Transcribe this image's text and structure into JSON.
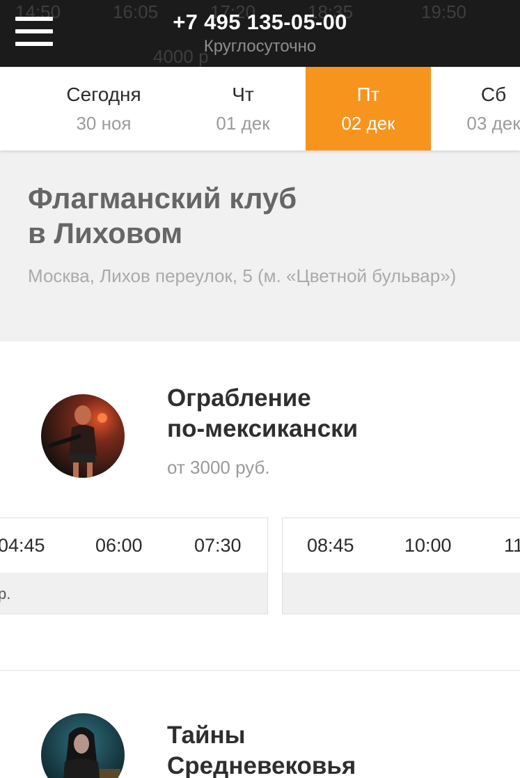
{
  "header": {
    "ghost_times": [
      "14:50",
      "16:05",
      "17:20",
      "18:35",
      "19:50"
    ],
    "ghost_price": "4000 р",
    "phone": "+7 495 135-05-00",
    "hours": "Круглосуточно"
  },
  "dates": [
    {
      "day": "Сегодня",
      "date": "30 ноя",
      "active": false
    },
    {
      "day": "Чт",
      "date": "01 дек",
      "active": false
    },
    {
      "day": "Пт",
      "date": "02 дек",
      "active": true
    },
    {
      "day": "Сб",
      "date": "03 дек",
      "active": false
    }
  ],
  "club": {
    "name_line1": "Флагманский клуб",
    "name_line2": "в Лиховом",
    "address": "Москва, Лихов переулок, 5 (м. «Цветной бульвар»)"
  },
  "quests": [
    {
      "title_line1": "Ограбление",
      "title_line2": "по-мексикански",
      "price": "от 3000 руб.",
      "slots_a": [
        "04:45",
        "06:00",
        "07:30"
      ],
      "slots_a_note": "р.",
      "slots_b": [
        "08:45",
        "10:00",
        "11"
      ]
    },
    {
      "title_line1": "Тайны",
      "title_line2": "Средневековья"
    }
  ],
  "colors": {
    "header_bg": "#1b1b1b",
    "accent": "#f7941d",
    "club_bg": "#f1f1f1"
  }
}
